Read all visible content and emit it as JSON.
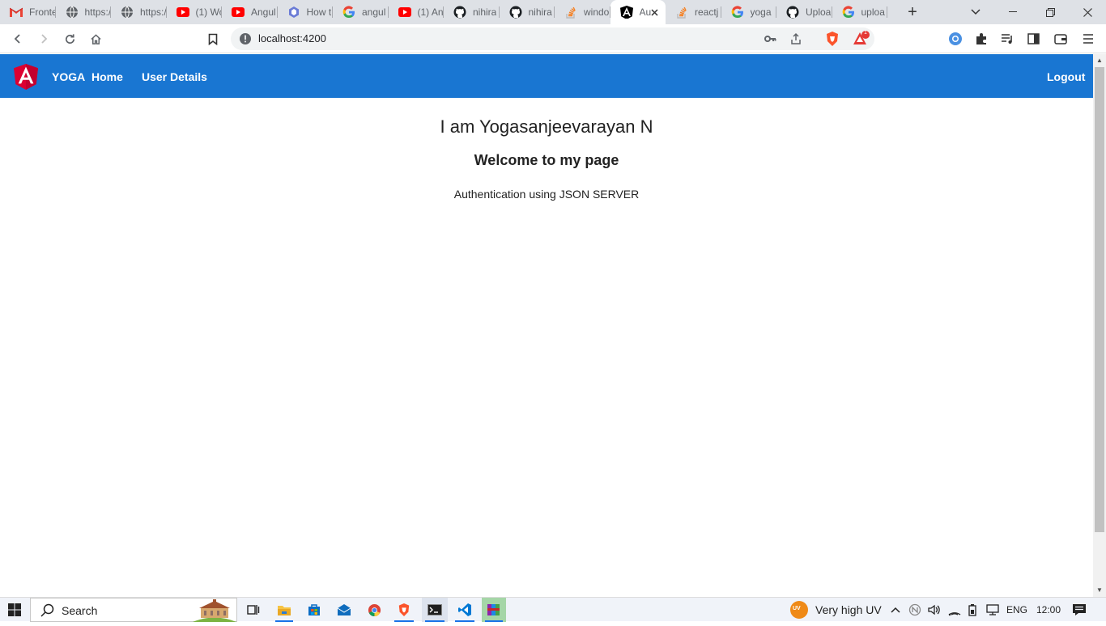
{
  "browser": {
    "tabs": [
      {
        "title": "Frontend",
        "icon": "gmail-icon"
      },
      {
        "title": "https://",
        "icon": "globe-icon"
      },
      {
        "title": "https://",
        "icon": "globe-icon"
      },
      {
        "title": "(1) Wo",
        "icon": "youtube-icon"
      },
      {
        "title": "Angul",
        "icon": "youtube-icon"
      },
      {
        "title": "How t",
        "icon": "hex-icon"
      },
      {
        "title": "angul",
        "icon": "google-icon"
      },
      {
        "title": "(1) An",
        "icon": "youtube-icon"
      },
      {
        "title": "nihira",
        "icon": "github-icon"
      },
      {
        "title": "nihira",
        "icon": "github-icon"
      },
      {
        "title": "windo",
        "icon": "stackoverflow-icon"
      },
      {
        "title": "Au",
        "icon": "angular-icon",
        "active": true
      },
      {
        "title": "reactj",
        "icon": "stackoverflow-icon"
      },
      {
        "title": "yoga",
        "icon": "google-icon"
      },
      {
        "title": "Uploa",
        "icon": "github-icon"
      },
      {
        "title": "uploa",
        "icon": "google-icon"
      }
    ],
    "new_tab_label": "+",
    "url": "localhost:4200",
    "brave_badge_count": "1"
  },
  "navbar": {
    "brand": "YOGA",
    "home": "Home",
    "user_details": "User Details",
    "logout": "Logout",
    "color": "#1976d2"
  },
  "content": {
    "title": "I am Yogasanjeevarayan N",
    "subtitle": "Welcome to my page",
    "text": "Authentication using JSON SERVER"
  },
  "taskbar": {
    "search_label": "Search",
    "weather": "Very high UV",
    "uv_badge": "UV",
    "language": "ENG",
    "time": "12:00"
  }
}
